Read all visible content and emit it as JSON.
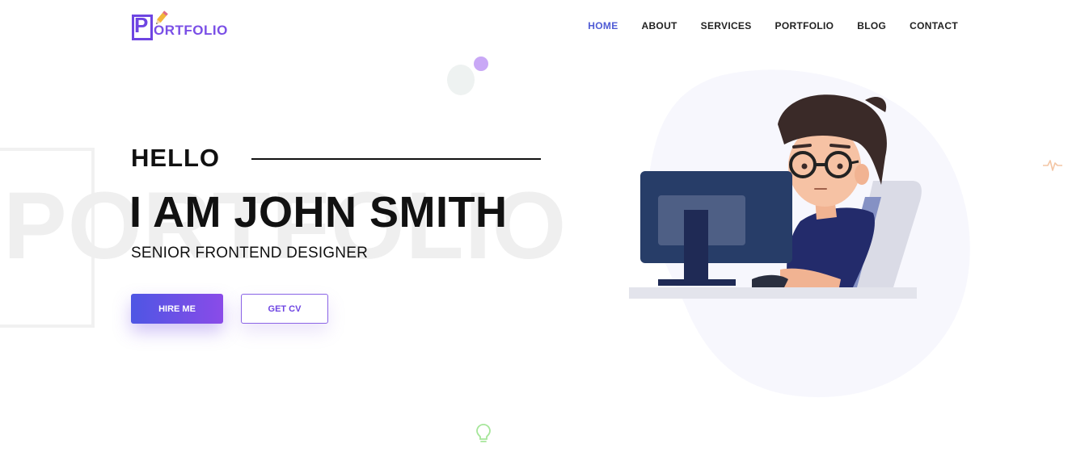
{
  "logo": {
    "letter": "P",
    "text": "ORTFOLIO",
    "icon": "pencil-icon"
  },
  "nav": {
    "items": [
      {
        "label": "HOME",
        "active": true
      },
      {
        "label": "ABOUT",
        "active": false
      },
      {
        "label": "SERVICES",
        "active": false
      },
      {
        "label": "PORTFOLIO",
        "active": false
      },
      {
        "label": "BLOG",
        "active": false
      },
      {
        "label": "CONTACT",
        "active": false
      }
    ]
  },
  "hero": {
    "background_word": "PORTFOLIO",
    "greeting": "HELLO",
    "name": "I AM JOHN SMITH",
    "role": "SENIOR FRONTEND DESIGNER",
    "hire_button": "HIRE ME",
    "cv_button": "GET CV"
  },
  "colors": {
    "accent": "#4f5bd5",
    "brand_purple": "#6e45e2",
    "button_gradient_start": "#4e56e4",
    "button_gradient_end": "#8a4be8"
  },
  "icons": [
    "pencil-icon",
    "pulse-icon",
    "lightbulb-icon"
  ]
}
